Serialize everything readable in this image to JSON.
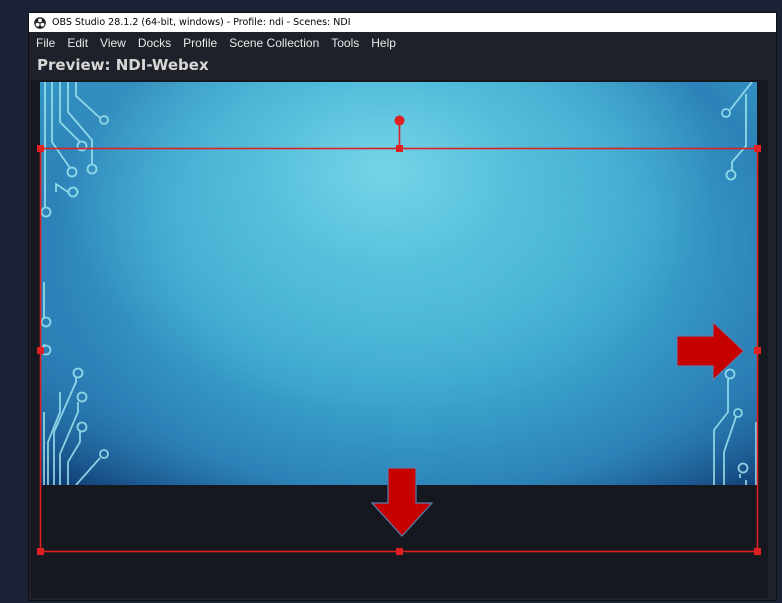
{
  "window": {
    "title": "OBS Studio 28.1.2 (64-bit, windows) - Profile: ndi - Scenes: NDI",
    "icon": "obs-logo-icon"
  },
  "menubar": {
    "items": [
      {
        "label": "File"
      },
      {
        "label": "Edit"
      },
      {
        "label": "View"
      },
      {
        "label": "Docks"
      },
      {
        "label": "Profile"
      },
      {
        "label": "Scene Collection"
      },
      {
        "label": "Tools"
      },
      {
        "label": "Help"
      }
    ]
  },
  "preview": {
    "label": "Preview: NDI-Webex"
  },
  "source": {
    "selected": true,
    "selection_color": "#e02020",
    "arrow_color": "#cc0000",
    "annotations": [
      "right-arrow-icon",
      "down-arrow-icon"
    ]
  },
  "colors": {
    "window_bg": "#1e2129",
    "preview_bg": "#16181f",
    "desktop_bg": "#1b2236"
  }
}
